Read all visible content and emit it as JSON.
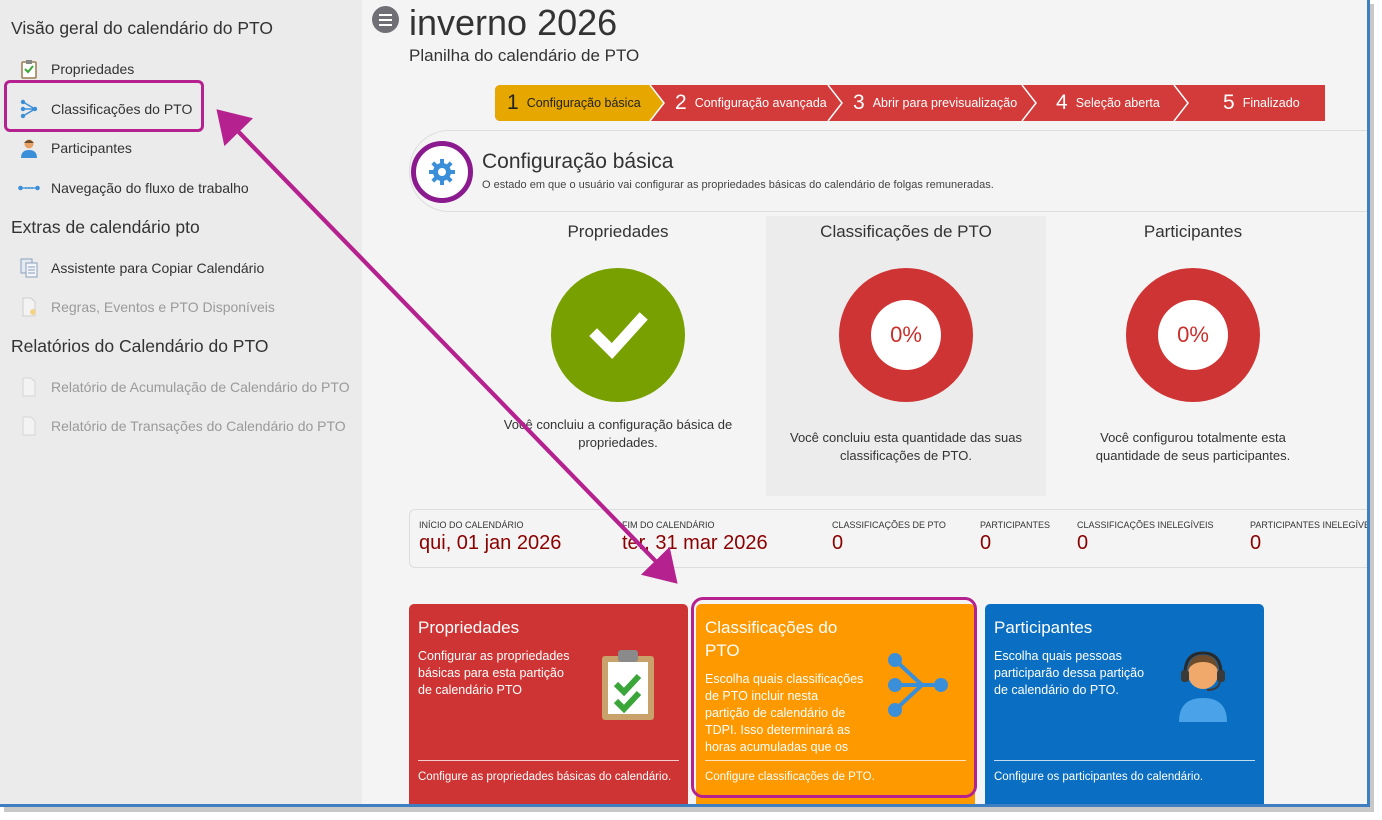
{
  "sidebar": {
    "section1": "Visão geral do calendário do PTO",
    "items1": [
      {
        "label": "Propriedades",
        "icon": "clipboard-check-icon"
      },
      {
        "label": "Classificações do PTO",
        "icon": "classification-icon"
      },
      {
        "label": "Participantes",
        "icon": "person-icon"
      },
      {
        "label": "Navegação do fluxo de trabalho",
        "icon": "workflow-icon"
      }
    ],
    "section2": "Extras de calendário pto",
    "items2": [
      {
        "label": "Assistente para Copiar Calendário",
        "icon": "copy-document-icon"
      },
      {
        "label": "Regras, Eventos e PTO Disponíveis",
        "icon": "document-icon"
      }
    ],
    "section3": "Relatórios do Calendário do PTO",
    "items3": [
      {
        "label": "Relatório de Acumulação de Calendário do PTO",
        "icon": "document-icon"
      },
      {
        "label": "Relatório de Transações do Calendário do PTO",
        "icon": "document-icon"
      }
    ]
  },
  "header": {
    "title": "inverno 2026",
    "subtitle": "Planilha do calendário de PTO"
  },
  "wizard": {
    "steps": [
      {
        "num": "1",
        "label": "Configuração básica"
      },
      {
        "num": "2",
        "label": "Configuração avançada"
      },
      {
        "num": "3",
        "label": "Abrir para previsualização"
      },
      {
        "num": "4",
        "label": "Seleção aberta"
      },
      {
        "num": "5",
        "label": "Finalizado"
      }
    ],
    "active_color": "#e6a800",
    "inactive_color": "#d33a3a"
  },
  "config": {
    "title": "Configuração básica",
    "description": "O estado em que o usuário vai configurar as propriedades básicas do calendário de folgas remuneradas."
  },
  "stats": [
    {
      "title": "Propriedades",
      "value": "",
      "desc_line1": "Você concluiu a configuração básica de",
      "desc_line2": "propriedades."
    },
    {
      "title": "Classificações de PTO",
      "value": "0%",
      "desc_line1": "Você concluiu esta quantidade das suas",
      "desc_line2": "classificações de PTO."
    },
    {
      "title": "Participantes",
      "value": "0%",
      "desc_line1": "Você configurou totalmente esta",
      "desc_line2": "quantidade de seus participantes."
    }
  ],
  "info": [
    {
      "label": "INÍCIO DO CALENDÁRIO",
      "value": "qui, 01 jan 2026"
    },
    {
      "label": "FIM DO CALENDÁRIO",
      "value": "ter, 31 mar 2026"
    },
    {
      "label": "CLASSIFICAÇÕES DE PTO",
      "value": "0"
    },
    {
      "label": "PARTICIPANTES",
      "value": "0"
    },
    {
      "label": "CLASSIFICAÇÕES INELEGÍVEIS",
      "value": "0"
    },
    {
      "label": "PARTICIPANTES INELEGÍVEIS",
      "value": "0"
    }
  ],
  "cards": [
    {
      "title": "Propriedades",
      "body_lines": [
        "Configurar as propriedades",
        "básicas para esta partição",
        "de calendário PTO"
      ],
      "footer": "Configure as propriedades básicas do calendário.",
      "color": "#cf3434"
    },
    {
      "title_lines": [
        "Classificações do",
        "PTO"
      ],
      "body_lines": [
        "Escolha quais classificações",
        "de PTO incluir nesta",
        "partição de calendário de",
        "TDPI. Isso determinará as",
        "horas acumuladas que os"
      ],
      "footer": "Configure classificações de PTO.",
      "color": "#ff9900"
    },
    {
      "title": "Participantes",
      "body_lines": [
        "Escolha quais pessoas",
        "participarão dessa partição",
        "de calendário do PTO."
      ],
      "footer": "Configure os participantes do calendário.",
      "color": "#0a6fc2"
    }
  ],
  "colors": {
    "complete": "#77a000",
    "incomplete": "#cf3434",
    "highlight": "#b5228f"
  }
}
